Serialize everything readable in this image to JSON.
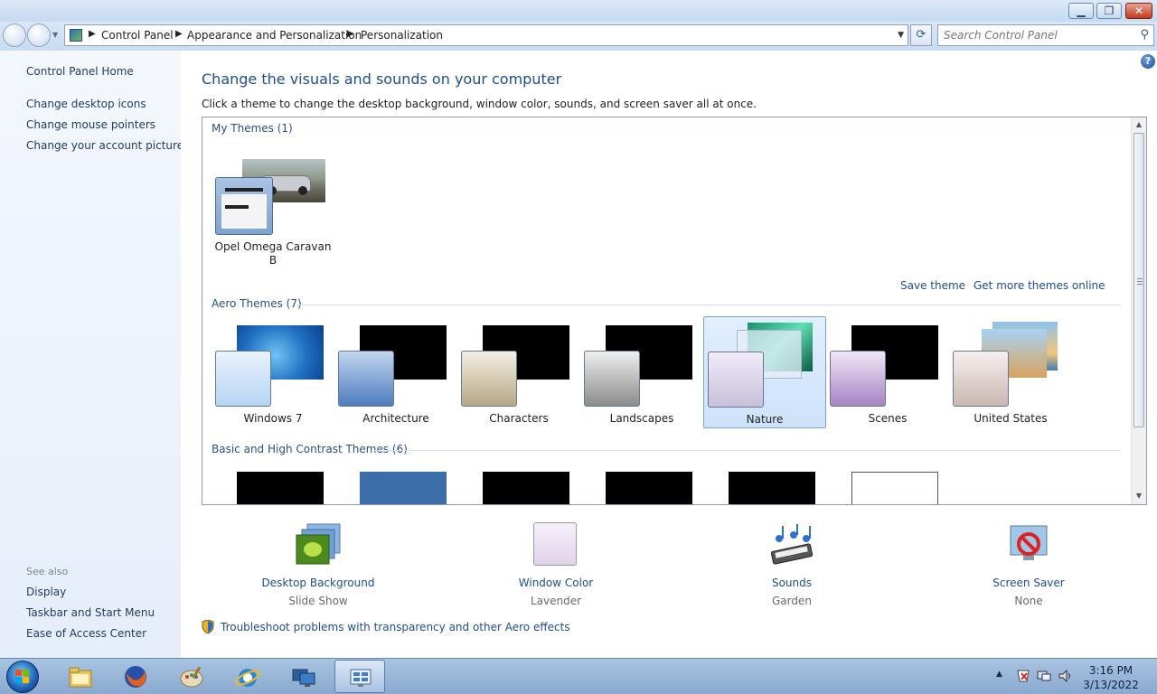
{
  "window": {
    "min_label": "▁",
    "max_label": "❐",
    "close_label": "✕"
  },
  "address": {
    "crumbs": [
      "Control Panel",
      "Appearance and Personalization",
      "Personalization"
    ]
  },
  "search": {
    "placeholder": "Search Control Panel"
  },
  "left_nav": {
    "home": "Control Panel Home",
    "links": [
      "Change desktop icons",
      "Change mouse pointers",
      "Change your account picture"
    ],
    "see_also_label": "See also",
    "see_also": [
      "Display",
      "Taskbar and Start Menu",
      "Ease of Access Center"
    ]
  },
  "main": {
    "title": "Change the visuals and sounds on your computer",
    "subtitle": "Click a theme to change the desktop background, window color, sounds, and screen saver all at once.",
    "help_label": "?"
  },
  "themes": {
    "my_section": "My Themes (1)",
    "my_theme_name": "Opel Omega Caravan B",
    "save_theme": "Save theme",
    "get_more": "Get more themes online",
    "aero_section": "Aero Themes (7)",
    "aero": [
      "Windows 7",
      "Architecture",
      "Characters",
      "Landscapes",
      "Nature",
      "Scenes",
      "United States"
    ],
    "selected": "Nature",
    "basic_section": "Basic and High Contrast Themes (6)"
  },
  "settings": [
    {
      "name": "Desktop Background",
      "value": "Slide Show",
      "icon": "desktop-background-icon"
    },
    {
      "name": "Window Color",
      "value": "Lavender",
      "icon": "window-color-icon"
    },
    {
      "name": "Sounds",
      "value": "Garden",
      "icon": "sounds-icon"
    },
    {
      "name": "Screen Saver",
      "value": "None",
      "icon": "screen-saver-icon"
    }
  ],
  "troubleshoot": "Troubleshoot problems with transparency and other Aero effects",
  "taskbar": {
    "time": "3:16 PM",
    "date": "3/13/2022",
    "apps": [
      "windows-explorer",
      "firefox",
      "paint",
      "internet-explorer",
      "remote-desktop",
      "control-panel"
    ]
  },
  "colors": {
    "accent": "#1e4e8c",
    "selection": "#cde2fa",
    "window_color_lavender": "#e9dff0"
  }
}
